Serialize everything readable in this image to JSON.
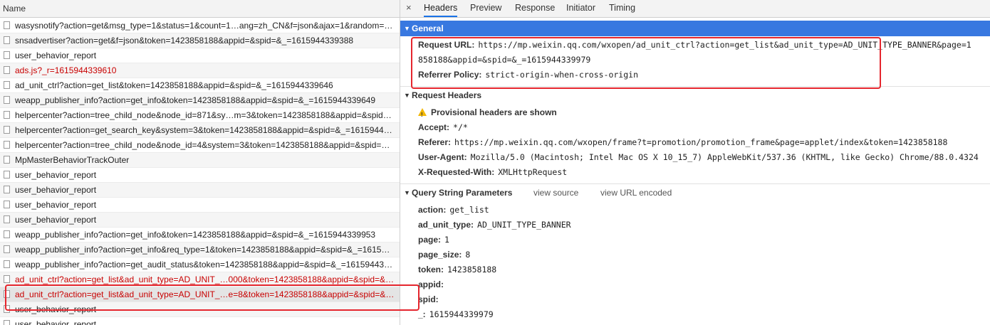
{
  "left": {
    "header": "Name",
    "rows": [
      {
        "name": "wasysnotify?action=get&msg_type=1&status=1&count=1…ang=zh_CN&f=json&ajax=1&random=…",
        "red": false
      },
      {
        "name": "snsadvertiser?action=get&f=json&token=1423858188&appid=&spid=&_=1615944339388",
        "red": false
      },
      {
        "name": "user_behavior_report",
        "red": false
      },
      {
        "name": "ads.js?_r=1615944339610",
        "red": true
      },
      {
        "name": "ad_unit_ctrl?action=get_list&token=1423858188&appid=&spid=&_=1615944339646",
        "red": false
      },
      {
        "name": "weapp_publisher_info?action=get_info&token=1423858188&appid=&spid=&_=1615944339649",
        "red": false
      },
      {
        "name": "helpercenter?action=tree_child_node&node_id=871&sy…m=3&token=1423858188&appid=&spid…",
        "red": false
      },
      {
        "name": "helpercenter?action=get_search_key&system=3&token=1423858188&appid=&spid=&_=1615944…",
        "red": false
      },
      {
        "name": "helpercenter?action=tree_child_node&node_id=4&system=3&token=1423858188&appid=&spid=…",
        "red": false
      },
      {
        "name": "MpMasterBehaviorTrackOuter",
        "red": false
      },
      {
        "name": "user_behavior_report",
        "red": false
      },
      {
        "name": "user_behavior_report",
        "red": false
      },
      {
        "name": "user_behavior_report",
        "red": false
      },
      {
        "name": "user_behavior_report",
        "red": false
      },
      {
        "name": "weapp_publisher_info?action=get_info&token=1423858188&appid=&spid=&_=1615944339953",
        "red": false
      },
      {
        "name": "weapp_publisher_info?action=get_info&req_type=1&token=1423858188&appid=&spid=&_=1615…",
        "red": false
      },
      {
        "name": "weapp_publisher_info?action=get_audit_status&token=1423858188&appid=&spid=&_=16159443…",
        "red": false
      },
      {
        "name": "ad_unit_ctrl?action=get_list&ad_unit_type=AD_UNIT_…000&token=1423858188&appid=&spid=&…",
        "red": true
      },
      {
        "name": "ad_unit_ctrl?action=get_list&ad_unit_type=AD_UNIT_…e=8&token=1423858188&appid=&spid=&…",
        "red": true
      },
      {
        "name": "user_behavior_report",
        "red": false
      },
      {
        "name": "user_behavior_report",
        "red": false
      }
    ]
  },
  "tabs": {
    "close": "×",
    "items": [
      "Headers",
      "Preview",
      "Response",
      "Initiator",
      "Timing"
    ]
  },
  "general": {
    "title": "General",
    "request_url_key": "Request URL:",
    "request_url_value": "https://mp.weixin.qq.com/wxopen/ad_unit_ctrl?action=get_list&ad_unit_type=AD_UNIT_TYPE_BANNER&page=1",
    "request_url_cont": "858188&appid=&spid=&_=1615944339979",
    "referrer_key": "Referrer Policy:",
    "referrer_value": "strict-origin-when-cross-origin"
  },
  "request_headers": {
    "title": "Request Headers",
    "provisional": "Provisional headers are shown",
    "accept_key": "Accept:",
    "accept_value": "*/*",
    "referer_key": "Referer:",
    "referer_value": "https://mp.weixin.qq.com/wxopen/frame?t=promotion/promotion_frame&page=applet/index&token=1423858188",
    "ua_key": "User-Agent:",
    "ua_value": "Mozilla/5.0 (Macintosh; Intel Mac OS X 10_15_7) AppleWebKit/537.36 (KHTML, like Gecko) Chrome/88.0.4324",
    "xrw_key": "X-Requested-With:",
    "xrw_value": "XMLHttpRequest"
  },
  "query": {
    "title": "Query String Parameters",
    "view_source": "view source",
    "view_url_encoded": "view URL encoded",
    "params": [
      {
        "k": "action:",
        "v": "get_list"
      },
      {
        "k": "ad_unit_type:",
        "v": "AD_UNIT_TYPE_BANNER"
      },
      {
        "k": "page:",
        "v": "1"
      },
      {
        "k": "page_size:",
        "v": "8"
      },
      {
        "k": "token:",
        "v": "1423858188"
      },
      {
        "k": "appid:",
        "v": ""
      },
      {
        "k": "spid:",
        "v": ""
      },
      {
        "k": "_:",
        "v": "1615944339979"
      }
    ]
  },
  "colors": {
    "accent": "#3878e0",
    "error_red": "#c80000",
    "annotation": "#e5262e"
  }
}
